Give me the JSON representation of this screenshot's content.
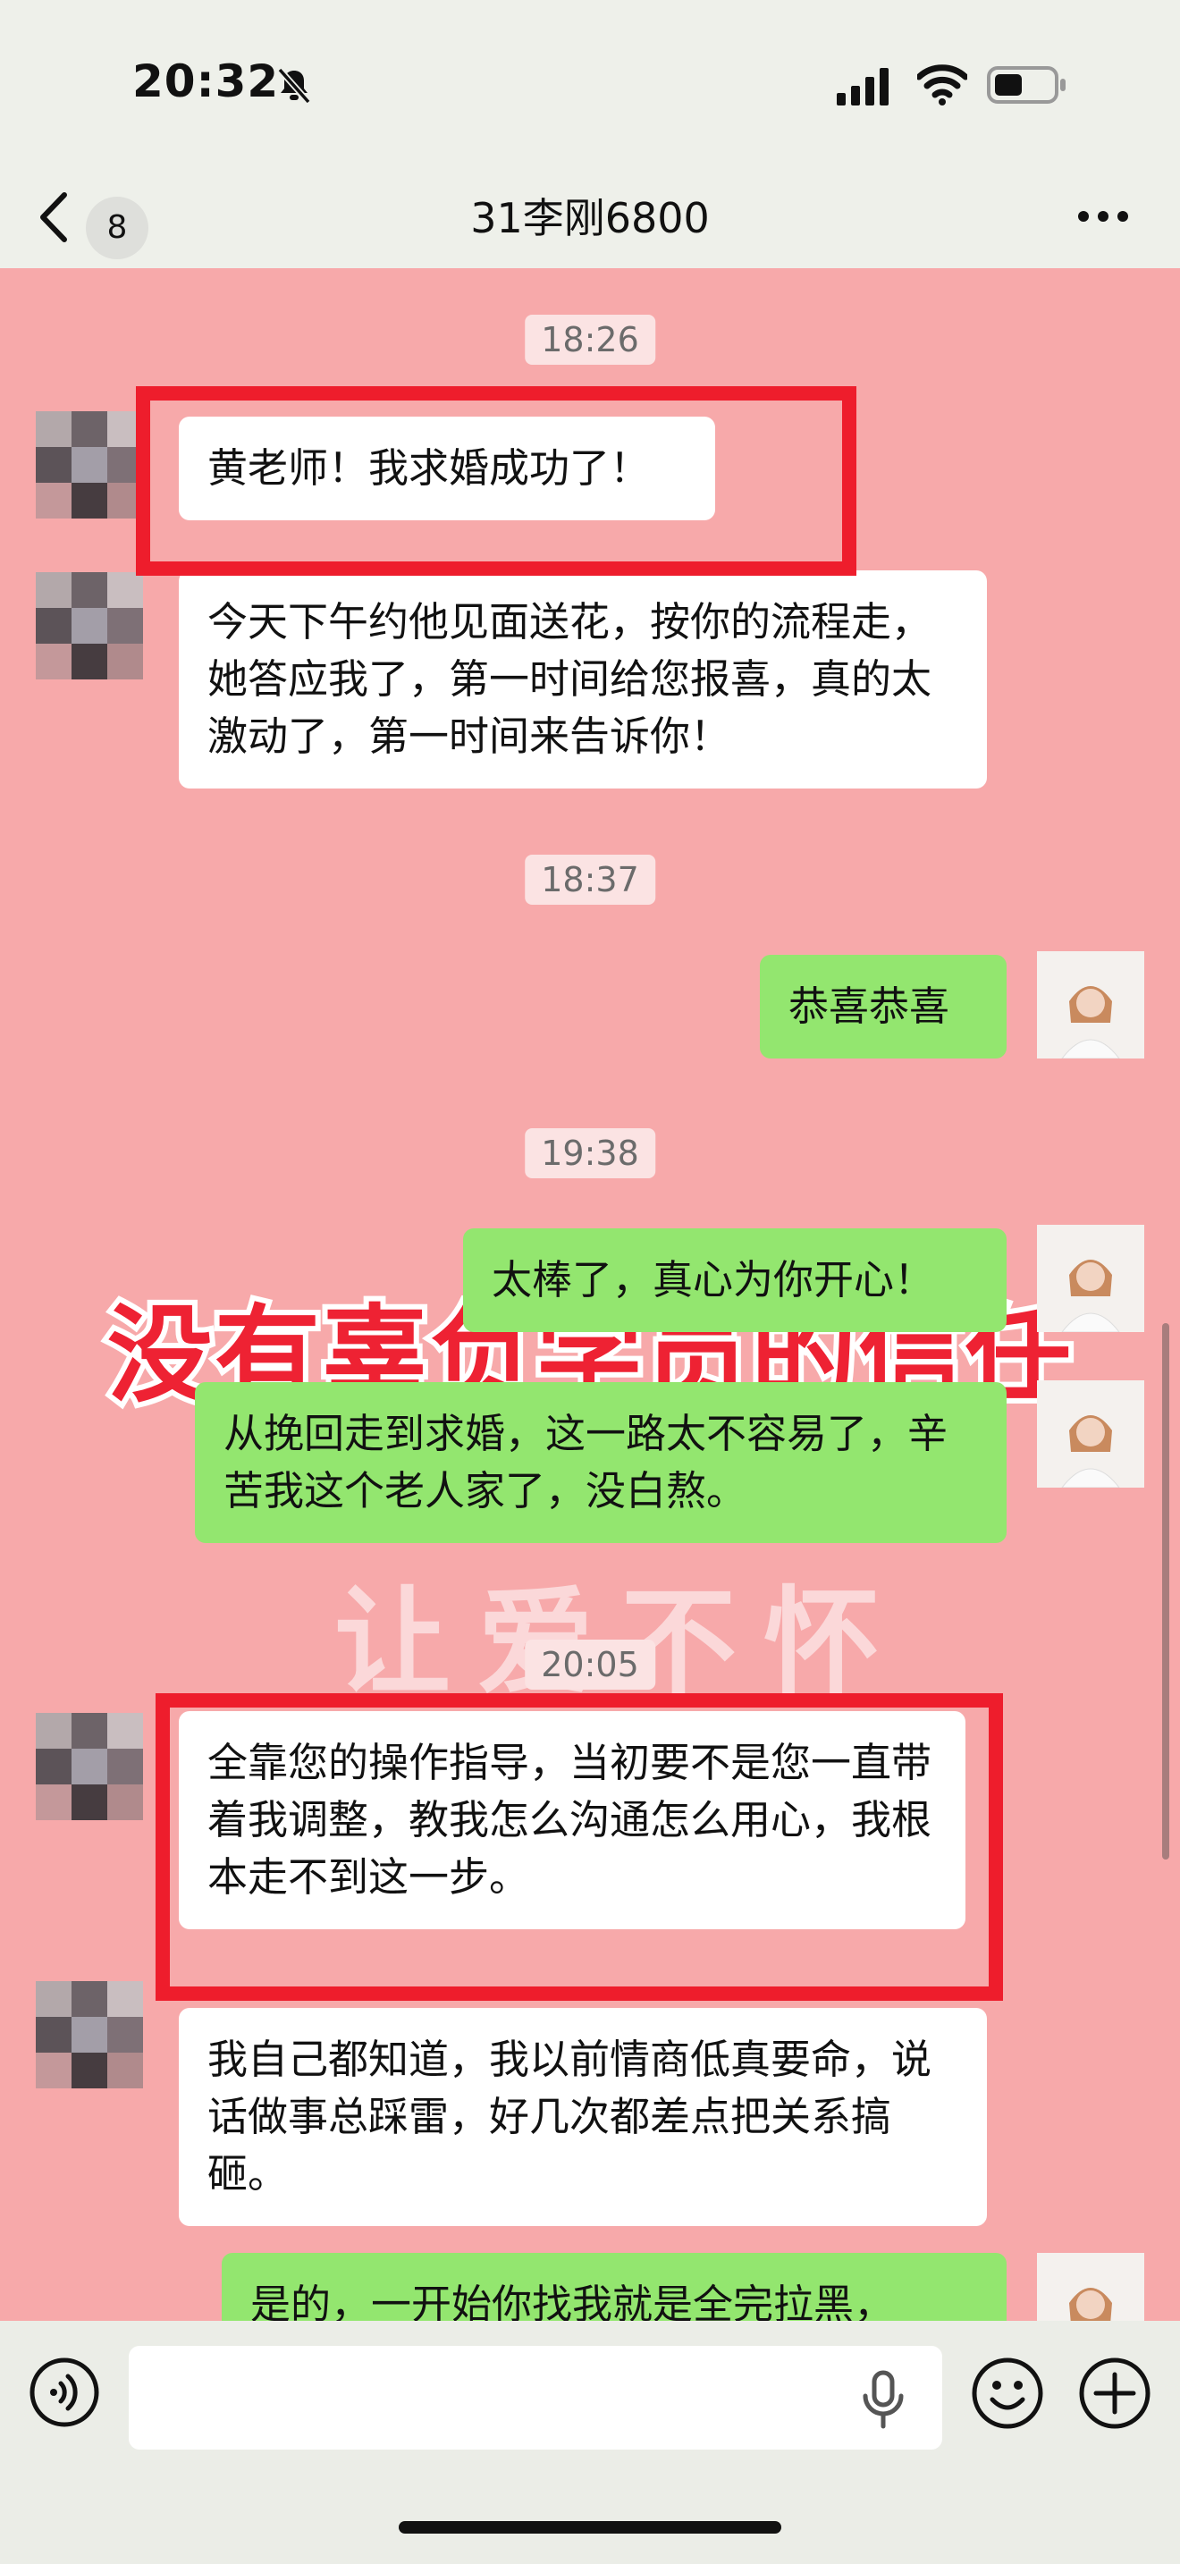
{
  "status": {
    "time": "20:32"
  },
  "nav": {
    "unread": "8",
    "title": "31李刚6800"
  },
  "timestamps": [
    "18:26",
    "18:37",
    "19:38",
    "20:05"
  ],
  "messages": [
    {
      "side": "left",
      "text": "黄老师！我求婚成功了！"
    },
    {
      "side": "left",
      "text": "今天下午约他见面送花，按你的流程走，她答应我了，第一时间给您报喜，真的太激动了，第一时间来告诉你！"
    },
    {
      "side": "right",
      "text": "恭喜恭喜"
    },
    {
      "side": "right",
      "text": "太棒了，真心为你开心！"
    },
    {
      "side": "right",
      "text": "从挽回走到求婚，这一路太不容易了，辛苦我这个老人家了，没白熬。"
    },
    {
      "side": "left",
      "text": "全靠您的操作指导，当初要不是您一直带着我调整，教我怎么沟通怎么用心，我根本走不到这一步。"
    },
    {
      "side": "left",
      "text": "我自己都知道，我以前情商低真要命，说话做事总踩雷，好几次都差点把关系搞砸。"
    },
    {
      "side": "right",
      "text": "是的，一开始你找我就是全完拉黑，"
    }
  ],
  "overlay_caption": "没有辜负学员的信任",
  "watermark": "让爱不怀",
  "colors": {
    "chat_bg": "#f7a9aa",
    "sent_bubble": "#93e66f",
    "received_bubble": "#ffffff",
    "highlight": "#ee1d2c"
  },
  "icons": [
    "back-chevron-icon",
    "mute-bell-icon",
    "signal-icon",
    "wifi-icon",
    "battery-icon",
    "more-icon",
    "voice-icon",
    "microphone-icon",
    "emoji-icon",
    "plus-icon"
  ]
}
